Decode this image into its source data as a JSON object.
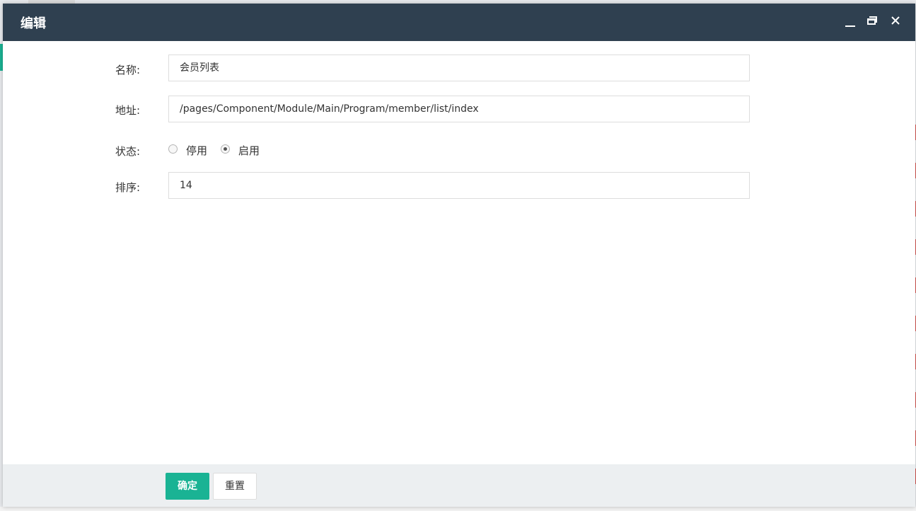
{
  "dialog": {
    "title": "编辑",
    "controls": {
      "minimize_icon": "minimize-icon",
      "maximize_icon": "maximize-icon",
      "close_icon": "close-icon"
    }
  },
  "form": {
    "name": {
      "label": "名称:",
      "value": "会员列表"
    },
    "url": {
      "label": "地址:",
      "value": "/pages/Component/Module/Main/Program/member/list/index"
    },
    "status": {
      "label": "状态:",
      "options": [
        {
          "label": "停用",
          "checked": false
        },
        {
          "label": "启用",
          "checked": true
        }
      ]
    },
    "sort": {
      "label": "排序:",
      "value": "14"
    }
  },
  "footer": {
    "confirm_label": "确定",
    "reset_label": "重置"
  },
  "colors": {
    "titlebar": "#2f4050",
    "primary": "#1ab394",
    "footer_bg": "#eceff1"
  }
}
